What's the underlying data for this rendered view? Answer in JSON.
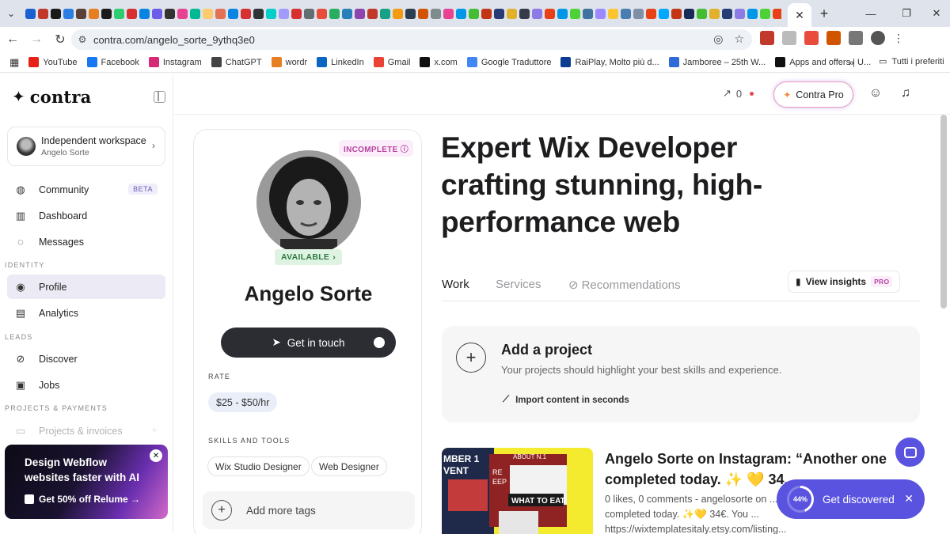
{
  "browser": {
    "url": "contra.com/angelo_sorte_9ythq3e0",
    "favicon_colors": [
      "#1c5fd0",
      "#c0392b",
      "#1a1a1a",
      "#2a7de1",
      "#5d4037",
      "#e67e22",
      "#1a1a1a",
      "#2ecc71",
      "#d63031",
      "#0984e3",
      "#6c5ce7",
      "#333333",
      "#e84393",
      "#00b894",
      "#fdcb6e",
      "#e17055",
      "#0984e3",
      "#d63031",
      "#2d3436",
      "#00cec9",
      "#a29bfe",
      "#d63031",
      "#636e72",
      "#e74c3c",
      "#27ae60",
      "#2980b9",
      "#8e44ad",
      "#c0392b",
      "#16a085",
      "#f39c12",
      "#2c3e50",
      "#d35400",
      "#7f8c8d",
      "#e84393",
      "#0097e6",
      "#44bd32",
      "#c23616",
      "#273c75",
      "#e1b12c",
      "#353b48",
      "#8c7ae6",
      "#e84118",
      "#0097e6",
      "#4cd137",
      "#40739e",
      "#9c88ff",
      "#fbc531",
      "#487eb0",
      "#7f8fa6",
      "#e84118",
      "#00a8ff",
      "#c23616",
      "#192a56",
      "#44bd32",
      "#e1b12c",
      "#273c75",
      "#8c7ae6",
      "#0097e6",
      "#4cd137",
      "#e84118",
      "#fbc531",
      "#2f3640",
      "#f5f6fa",
      "#e84118",
      "#00a8ff",
      "#c23616",
      "#44bd32",
      "#8c7ae6",
      "#273c75",
      "#e1b12c"
    ],
    "bookmarks": [
      {
        "label": "YouTube",
        "color": "#e62117"
      },
      {
        "label": "Facebook",
        "color": "#1877f2"
      },
      {
        "label": "Instagram",
        "color": "#d62976"
      },
      {
        "label": "ChatGPT",
        "color": "#444444"
      },
      {
        "label": "wordr",
        "color": "#e67e22"
      },
      {
        "label": "LinkedIn",
        "color": "#0a66c2"
      },
      {
        "label": "Gmail",
        "color": "#ea4335"
      },
      {
        "label": "x.com",
        "color": "#111111"
      },
      {
        "label": "Google Traduttore",
        "color": "#4285f4"
      },
      {
        "label": "RaiPlay, Molto più d...",
        "color": "#0b3d91"
      },
      {
        "label": "Jamboree – 25th W...",
        "color": "#2e6bd6"
      },
      {
        "label": "Apps and offers | U...",
        "color": "#111111"
      }
    ],
    "bookmarks_folder": "Tutti i preferiti"
  },
  "sidebar": {
    "logo_text": "contra",
    "workspace": {
      "title": "Independent workspace",
      "subtitle": "Angelo Sorte"
    },
    "items": [
      {
        "label": "Community",
        "icon": "globe-icon",
        "badge": "BETA"
      },
      {
        "label": "Dashboard",
        "icon": "building-icon"
      },
      {
        "label": "Messages",
        "icon": "chat-icon"
      }
    ],
    "section_identity": "IDENTITY",
    "identity_items": [
      {
        "label": "Profile",
        "icon": "user-icon",
        "active": true
      },
      {
        "label": "Analytics",
        "icon": "chart-icon"
      }
    ],
    "section_leads": "LEADS",
    "leads_items": [
      {
        "label": "Discover",
        "icon": "compass-icon"
      },
      {
        "label": "Jobs",
        "icon": "briefcase-icon"
      }
    ],
    "section_projects": "PROJECTS & PAYMENTS",
    "projects_items": [
      {
        "label": "Projects & invoices",
        "icon": "document-icon"
      }
    ],
    "promo": {
      "title": "Design Webflow websites faster with AI",
      "cta": "Get 50% off Relume →"
    }
  },
  "topbar": {
    "trend_count": "0",
    "pro_label": "Contra Pro"
  },
  "profile": {
    "status": "INCOMPLETE",
    "availability": "AVAILABLE",
    "name": "Angelo Sorte",
    "cta": "Get in touch",
    "rate_label": "RATE",
    "rate": "$25 - $50/hr",
    "skills_label": "SKILLS AND TOOLS",
    "skills": [
      "Wix Studio Designer",
      "Web Designer"
    ],
    "add_tags": "Add more tags"
  },
  "main": {
    "headline": "Expert Wix Developer crafting stunning, high-performance web",
    "tabs": [
      "Work",
      "Services",
      "Recommendations"
    ],
    "insights": {
      "label": "View insights",
      "badge": "PRO"
    },
    "add_project": {
      "title": "Add a project",
      "subtitle": "Your projects should highlight your best skills and experience.",
      "import": "Import content in seconds"
    },
    "post": {
      "title": "Angelo Sorte on Instagram: “Another one completed today. ✨ 💛  34...",
      "meta": "0 likes, 0 comments - angelosorte on ... one completed today. ✨💛 34€. You ... https://wixtemplatesitaly.etsy.com/listing...",
      "thumb_texts": [
        "MBER 1",
        "VENT",
        "ABOUT N.1",
        "RE",
        "EEP",
        "WHAT TO EAT"
      ]
    }
  },
  "discover_widget": {
    "percent": "44%",
    "percent_value": 44,
    "label": "Get discovered"
  }
}
